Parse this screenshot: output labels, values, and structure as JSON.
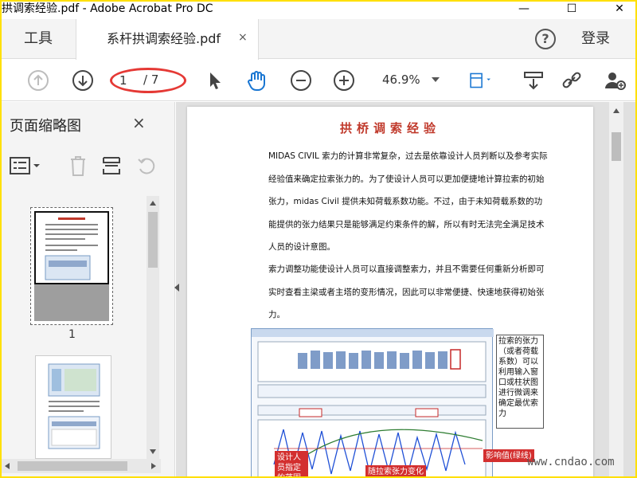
{
  "window": {
    "title": "拱调索经验.pdf - Adobe Acrobat Pro DC",
    "minimize": "—",
    "maximize": "☐",
    "close": "✕"
  },
  "tabs": {
    "tools": "工具",
    "document": "系杆拱调索经验.pdf",
    "document_close": "×",
    "help": "?",
    "sign_in": "登录"
  },
  "toolbar": {
    "page_current": "1",
    "page_total": "/ 7",
    "zoom": "46.9%"
  },
  "left_panel": {
    "title": "页面缩略图",
    "close": "×",
    "thumbnail_1_label": "1"
  },
  "document": {
    "heading": "拱桥调索经验",
    "paragraph_1": "MIDAS CIVIL 索力的计算非常复杂，过去是依靠设计人员判断以及参考实际经验值来确定拉索张力的。为了使设计人员可以更加便捷地计算拉索的初始张力，midas Civil 提供未知荷载系数功能。不过，由于未知荷载系数的功能提供的张力结果只是能够满足约束条件的解，所以有时无法完全满足技术人员的设计意图。",
    "paragraph_2": "索力调整功能使设计人员可以直接调整索力，并且不需要任何重新分析即可实时查看主梁或者主塔的变形情况，因此可以非常便捷、快速地获得初始张力。",
    "callout_right": "拉索的张力（或者荷载系数）可以利用输入窗口或柱状图进行微调来确定最优索力",
    "callout_designer": "设计人员指定的范围(红线)",
    "callout_change": "随拉索张力变化的结果(蓝线)",
    "callout_influence": "影响值(绿线)"
  },
  "watermark": "www.cndao.com"
}
